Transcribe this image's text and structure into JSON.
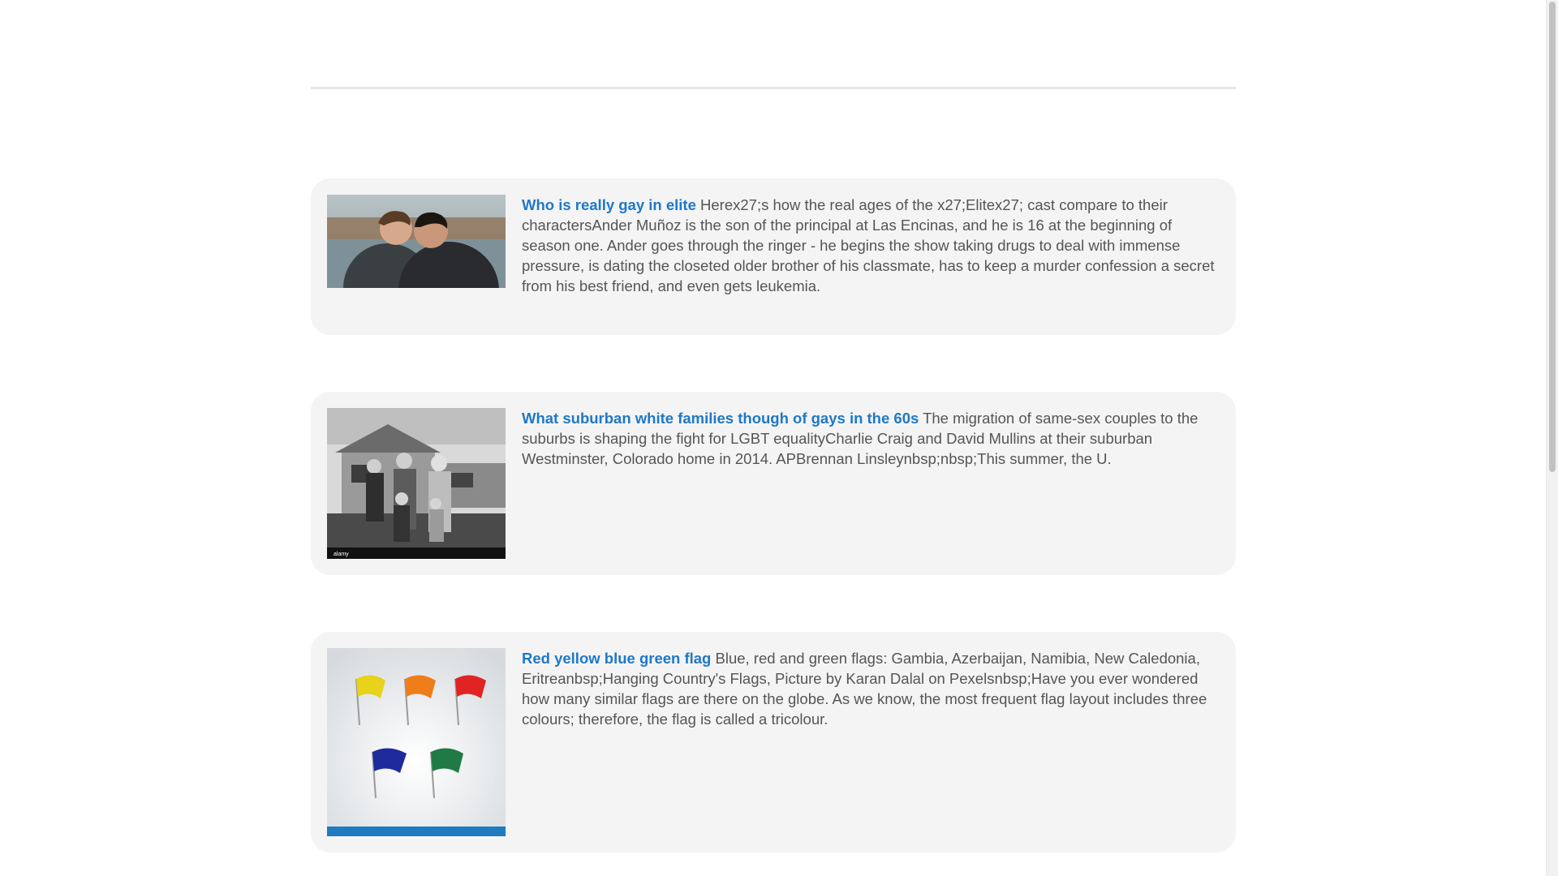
{
  "articles": [
    {
      "title": "Who is really gay in elite",
      "body": "Herex27;s how the real ages of the x27;Elitex27; cast compare to their charactersAnder Muñoz is the son of the principal at Las Encinas, and he is 16 at the beginning of season one. Ander goes through the ringer - he begins the show taking drugs to deal with immense pressure, is dating the closeted older brother of his classmate, has to keep a murder confession a secret from his best friend, and even gets leukemia."
    },
    {
      "title": "What suburban white families though of gays in the 60s",
      "body": "The migration of same-sex couples to the suburbs is shaping the fight for LGBT equalityCharlie Craig and David Mullins at their suburban Westminster, Colorado home in 2014. APBrennan Linsleynbsp;nbsp;This summer, the U."
    },
    {
      "title": "Red yellow blue green flag",
      "body": "Blue, red and green flags: Gambia, Azerbaijan, Namibia, New Caledonia, Eritreanbsp;Hanging Country's Flags, Picture by Karan Dalal on Pexelsnbsp;Have you ever wondered how many similar flags are there on the globe. As we know, the most frequent flag layout includes three colours; therefore, the flag is called a tricolour."
    }
  ],
  "image_marks": {
    "stock_watermark": "alamy"
  },
  "colors": {
    "link": "#1f78c8",
    "card_background": "#f4f4f4",
    "body_text": "#555555",
    "flag_colors": [
      "#e8d21a",
      "#ef7d1a",
      "#e02424",
      "#1f2a9c",
      "#1f7a45"
    ]
  }
}
